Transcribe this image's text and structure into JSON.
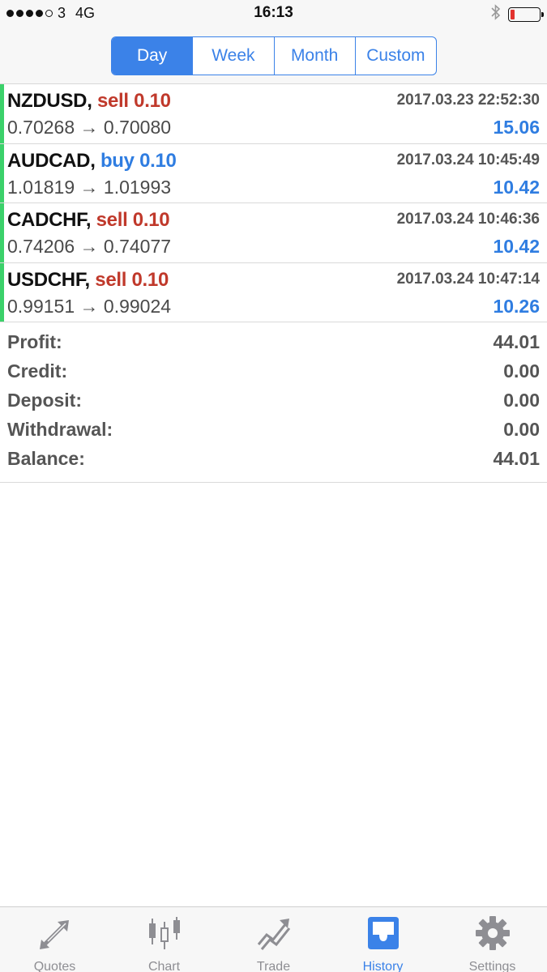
{
  "status_bar": {
    "signal_dots": [
      true,
      true,
      true,
      true,
      false
    ],
    "carrier": "3",
    "network": "4G",
    "time": "16:13",
    "battery_level": 0.15,
    "battery_color": "#e2322e"
  },
  "period_tabs": [
    {
      "label": "Day",
      "active": true
    },
    {
      "label": "Week",
      "active": false
    },
    {
      "label": "Month",
      "active": false
    },
    {
      "label": "Custom",
      "active": false
    }
  ],
  "deals": [
    {
      "symbol": "NZDUSD,",
      "side": "sell 0.10",
      "side_type": "sell",
      "time": "2017.03.23 22:52:30",
      "prices": "0.70268 → 0.70080",
      "profit": "15.06"
    },
    {
      "symbol": "AUDCAD,",
      "side": "buy 0.10",
      "side_type": "buy",
      "time": "2017.03.24 10:45:49",
      "prices": "1.01819 → 1.01993",
      "profit": "10.42"
    },
    {
      "symbol": "CADCHF,",
      "side": "sell 0.10",
      "side_type": "sell",
      "time": "2017.03.24 10:46:36",
      "prices": "0.74206 → 0.74077",
      "profit": "10.42"
    },
    {
      "symbol": "USDCHF,",
      "side": "sell 0.10",
      "side_type": "sell",
      "time": "2017.03.24 10:47:14",
      "prices": "0.99151 → 0.99024",
      "profit": "10.26"
    }
  ],
  "summary": {
    "profit_label": "Profit:",
    "profit": "44.01",
    "credit_label": "Credit:",
    "credit": "0.00",
    "deposit_label": "Deposit:",
    "deposit": "0.00",
    "withdrawal_label": "Withdrawal:",
    "withdrawal": "0.00",
    "balance_label": "Balance:",
    "balance": "44.01"
  },
  "tabbar": [
    {
      "label": "Quotes",
      "icon": "quotes-icon",
      "active": false
    },
    {
      "label": "Chart",
      "icon": "chart-icon",
      "active": false
    },
    {
      "label": "Trade",
      "icon": "trade-icon",
      "active": false
    },
    {
      "label": "History",
      "icon": "history-icon",
      "active": true
    },
    {
      "label": "Settings",
      "icon": "settings-icon",
      "active": false
    }
  ],
  "colors": {
    "accent": "#3b82e8",
    "sell": "#c0392b",
    "buy": "#2f7de1",
    "profit_positive": "#2f7de1",
    "deal_bar": "#3bd16a"
  }
}
